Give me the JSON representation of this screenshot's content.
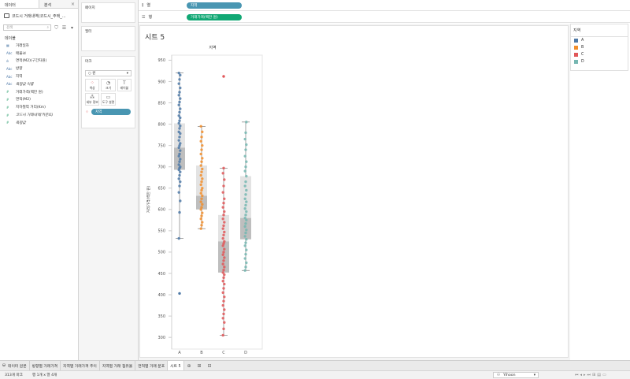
{
  "left_pane": {
    "tabs": [
      {
        "label": "데이터"
      },
      {
        "label": "분석"
      }
    ],
    "datasource": "코드시 거래내역(코드시_주택_...",
    "search_placeholder": "검색",
    "section_title": "데이블",
    "fields": [
      {
        "type": "date",
        "label": "거래일자"
      },
      {
        "type": "Abc",
        "label": "매물id"
      },
      {
        "type": "bin",
        "label": "면적(M2)(구간차원)"
      },
      {
        "type": "Abc",
        "label": "방향"
      },
      {
        "type": "Abc",
        "label": "지역"
      },
      {
        "type": "Abc",
        "label": "측정값 이름",
        "italic": true
      },
      {
        "type": "#",
        "label": "거래가격(백만 원)"
      },
      {
        "type": "#",
        "label": "면적(M2)"
      },
      {
        "type": "#",
        "label": "지하철역 거리(Km)"
      },
      {
        "type": "#",
        "label": "코드시 거래내역(카운트)",
        "italic": true
      },
      {
        "type": "#",
        "label": "측정값",
        "italic": true
      }
    ]
  },
  "shelves": {
    "pages_label": "페이지",
    "filters_label": "필터",
    "marks_label": "마크",
    "marks_type": "원",
    "marks_buttons": [
      {
        "icon": "color-icon",
        "label": "색상"
      },
      {
        "icon": "size-icon",
        "label": "크기"
      },
      {
        "icon": "label-icon",
        "label": "레이블"
      },
      {
        "icon": "detail-icon",
        "label": "세부 정보"
      },
      {
        "icon": "tooltip-icon",
        "label": "도구 설명"
      }
    ],
    "marks_pill": "지역",
    "columns_label": "열",
    "columns_pill": "지역",
    "rows_label": "행",
    "rows_pill": "거래가격(백만 원)"
  },
  "sheet_title": "시트 5",
  "legend": {
    "title": "지역",
    "items": [
      {
        "label": "A",
        "color": "#4e79a7"
      },
      {
        "label": "B",
        "color": "#f28e2b"
      },
      {
        "label": "C",
        "color": "#e15759"
      },
      {
        "label": "D",
        "color": "#76b7b2"
      }
    ]
  },
  "chart_data": {
    "type": "scatter",
    "subtype": "box-plot with jittered points",
    "title": "",
    "header": "지역",
    "xlabel": "",
    "ylabel": "거래가격(백만 원)",
    "categories": [
      "A",
      "B",
      "C",
      "D"
    ],
    "ylim": [
      280,
      960
    ],
    "yticks": [
      300,
      350,
      400,
      450,
      500,
      550,
      600,
      650,
      700,
      750,
      800,
      850,
      900,
      950
    ],
    "colors": [
      "#4e79a7",
      "#f28e2b",
      "#e15759",
      "#76b7b2"
    ],
    "boxes": [
      {
        "category": "A",
        "min": 532,
        "q1": 693,
        "median": 745,
        "q3": 802,
        "max": 920
      },
      {
        "category": "B",
        "min": 555,
        "q1": 600,
        "median": 632,
        "q3": 703,
        "max": 795
      },
      {
        "category": "C",
        "min": 305,
        "q1": 452,
        "median": 525,
        "q3": 587,
        "max": 697
      },
      {
        "category": "D",
        "min": 457,
        "q1": 530,
        "median": 580,
        "q3": 678,
        "max": 805
      }
    ],
    "outliers": [
      {
        "category": "A",
        "value": 403
      },
      {
        "category": "C",
        "value": 912
      }
    ],
    "points": [
      {
        "category": "A",
        "values": [
          532,
          593,
          620,
          640,
          655,
          665,
          672,
          680,
          688,
          693,
          697,
          700,
          705,
          712,
          718,
          725,
          730,
          738,
          745,
          750,
          755,
          762,
          770,
          778,
          782,
          790,
          796,
          802,
          808,
          815,
          820,
          828,
          836,
          845,
          852,
          860,
          868,
          875,
          885,
          895,
          905,
          915,
          920
        ]
      },
      {
        "category": "B",
        "values": [
          555,
          563,
          570,
          578,
          585,
          592,
          600,
          605,
          612,
          618,
          625,
          632,
          638,
          645,
          650,
          658,
          665,
          672,
          680,
          688,
          695,
          703,
          712,
          720,
          730,
          740,
          750,
          760,
          770,
          782,
          795
        ]
      },
      {
        "category": "C",
        "values": [
          305,
          320,
          335,
          345,
          355,
          365,
          375,
          385,
          395,
          405,
          415,
          425,
          432,
          440,
          447,
          452,
          458,
          465,
          472,
          480,
          487,
          494,
          500,
          507,
          515,
          520,
          525,
          532,
          540,
          547,
          555,
          562,
          570,
          578,
          587,
          595,
          605,
          615,
          625,
          640,
          655,
          670,
          685,
          697
        ]
      },
      {
        "category": "D",
        "values": [
          457,
          465,
          475,
          485,
          495,
          505,
          515,
          522,
          530,
          537,
          545,
          552,
          560,
          567,
          575,
          580,
          587,
          595,
          602,
          610,
          618,
          625,
          635,
          645,
          655,
          665,
          678,
          690,
          700,
          712,
          725,
          740,
          752,
          765,
          780,
          805
        ]
      }
    ]
  },
  "bottom_tabs": [
    {
      "label": "데이터 원본",
      "icon": "datasource-icon"
    },
    {
      "label": "방향별 거래가격"
    },
    {
      "label": "지역별 거래가격 추이"
    },
    {
      "label": "지역별 거래 점유율"
    },
    {
      "label": "면적별 거래 분포"
    },
    {
      "label": "시트 5",
      "active": true
    }
  ],
  "status": {
    "marks": "313개 마크",
    "rows_cols": "행 1개 x 열 4개",
    "user": "Yihoon"
  }
}
